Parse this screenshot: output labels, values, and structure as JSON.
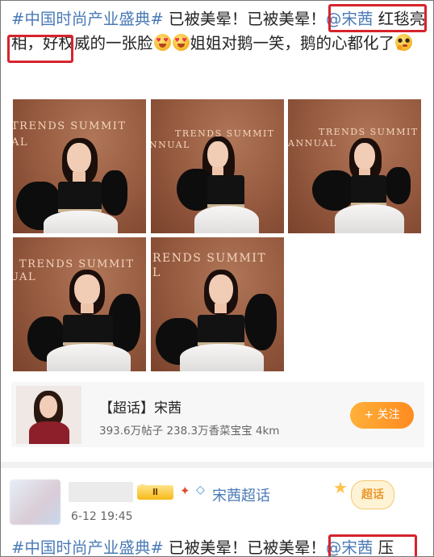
{
  "post1": {
    "topic": "#中国时尚产业盛典#",
    "text_a": " 已被美晕！已被美晕！",
    "mention": "@宋茜",
    "text_b": " 红毯亮相，好权威的一张脸",
    "text_c": "姐姐对鹅一笑，鹅的心都化了",
    "emojis": [
      "heart-eyes-emoji",
      "heart-eyes-emoji",
      "thinking-emoji"
    ]
  },
  "photos": [
    {
      "sign_a": "TRENDS SUMMIT",
      "sign_b": "AL"
    },
    {
      "sign_a": "TRENDS SUMMIT",
      "sign_b": "NNUAL"
    },
    {
      "sign_a": "TRENDS SUMMIT",
      "sign_b": "ANNUAL"
    },
    {
      "sign_a": "TRENDS SUMMIT",
      "sign_b": "UAL"
    },
    {
      "sign_a": "RENDS SUMMIT",
      "sign_b": "L"
    }
  ],
  "supertopic_card": {
    "title": "【超话】宋茜",
    "stats": "393.6万帖子 238.3万香菜宝宝 4km",
    "follow_label": "+ 关注"
  },
  "post2": {
    "vip_label": "Ⅱ",
    "supertopic_name": "宋茜超话",
    "time": "6-12 19:45",
    "sticker_label": "超话",
    "topic": "#中国时尚产业盛典#",
    "text_a": " 已被美晕！已被美晕！",
    "mention": "@宋茜",
    "text_b": " 压"
  },
  "colors": {
    "link": "#4a7ab6",
    "highlight": "#d6242c",
    "follow": "#ff9a2a",
    "backdrop": "#9a5e43"
  }
}
